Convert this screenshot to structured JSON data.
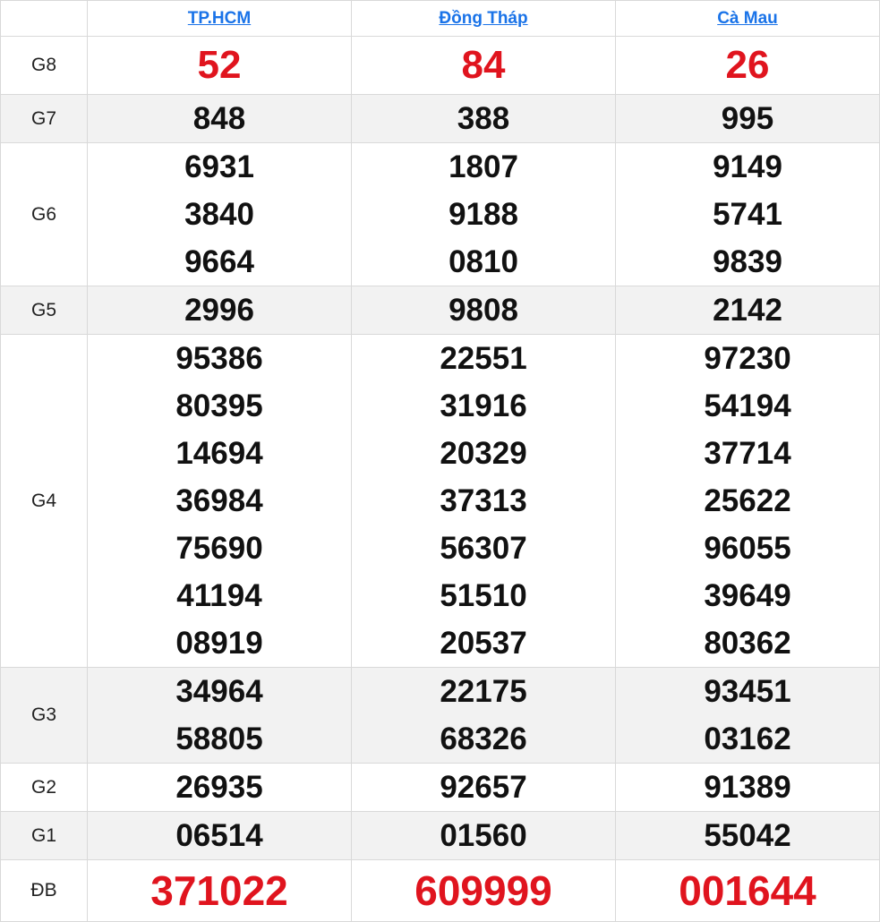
{
  "headers": [
    "TP.HCM",
    "Đồng Tháp",
    "Cà Mau"
  ],
  "prizes": [
    {
      "label": "G8",
      "values": [
        [
          "52"
        ],
        [
          "84"
        ],
        [
          "26"
        ]
      ]
    },
    {
      "label": "G7",
      "values": [
        [
          "848"
        ],
        [
          "388"
        ],
        [
          "995"
        ]
      ]
    },
    {
      "label": "G6",
      "values": [
        [
          "6931",
          "3840",
          "9664"
        ],
        [
          "1807",
          "9188",
          "0810"
        ],
        [
          "9149",
          "5741",
          "9839"
        ]
      ]
    },
    {
      "label": "G5",
      "values": [
        [
          "2996"
        ],
        [
          "9808"
        ],
        [
          "2142"
        ]
      ]
    },
    {
      "label": "G4",
      "values": [
        [
          "95386",
          "80395",
          "14694",
          "36984",
          "75690",
          "41194",
          "08919"
        ],
        [
          "22551",
          "31916",
          "20329",
          "37313",
          "56307",
          "51510",
          "20537"
        ],
        [
          "97230",
          "54194",
          "37714",
          "25622",
          "96055",
          "39649",
          "80362"
        ]
      ]
    },
    {
      "label": "G3",
      "values": [
        [
          "34964",
          "58805"
        ],
        [
          "22175",
          "68326"
        ],
        [
          "93451",
          "03162"
        ]
      ]
    },
    {
      "label": "G2",
      "values": [
        [
          "26935"
        ],
        [
          "92657"
        ],
        [
          "91389"
        ]
      ]
    },
    {
      "label": "G1",
      "values": [
        [
          "06514"
        ],
        [
          "01560"
        ],
        [
          "55042"
        ]
      ]
    },
    {
      "label": "ĐB",
      "values": [
        [
          "371022"
        ],
        [
          "609999"
        ],
        [
          "001644"
        ]
      ]
    }
  ],
  "colors": {
    "highlight": "#e0141e",
    "link": "#1a73e8",
    "shade": "#f2f2f2"
  }
}
